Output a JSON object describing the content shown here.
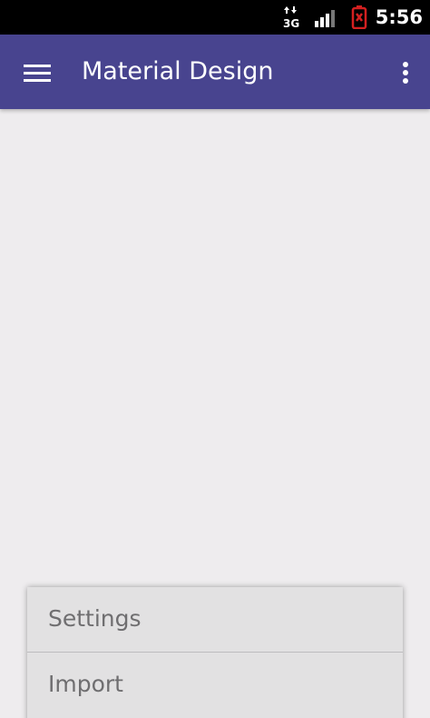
{
  "status_bar": {
    "network_type": "3G",
    "time": "5:56",
    "icons": [
      "data-3g-icon",
      "signal-strength-icon",
      "battery-alert-icon"
    ]
  },
  "app_bar": {
    "title": "Material Design",
    "menu_icon": "hamburger-menu-icon",
    "overflow_icon": "more-vert-icon"
  },
  "popup_menu": {
    "items": [
      {
        "label": "Settings"
      },
      {
        "label": "Import"
      }
    ]
  },
  "colors": {
    "primary": "#48448f",
    "background": "#eeecee",
    "menu_background": "#e2e1e2",
    "status_bar": "#000000",
    "battery_alert": "#d42020"
  }
}
